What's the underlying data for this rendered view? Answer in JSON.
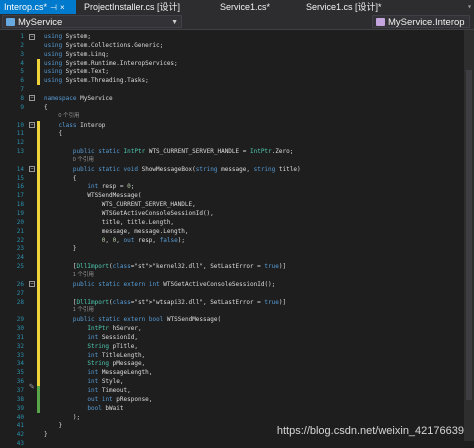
{
  "tabs": [
    {
      "label": "Interop.cs*",
      "icon": "pin-close",
      "active": true
    },
    {
      "label": "ProjectInstaller.cs [设计]",
      "icon": "close",
      "active": false
    },
    {
      "label": "Service1.cs*",
      "icon": "close",
      "active": false
    },
    {
      "label": "Service1.cs [设计]*",
      "icon": "close",
      "active": false
    }
  ],
  "navbar": {
    "project": "MyService",
    "class": "MyService.Interop"
  },
  "code_lines": [
    {
      "n": "1",
      "code": "using System;"
    },
    {
      "n": "2",
      "code": "using System.Collections.Generic;"
    },
    {
      "n": "3",
      "code": "using System.Linq;"
    },
    {
      "n": "4",
      "code": "using System.Runtime.InteropServices;"
    },
    {
      "n": "5",
      "code": "using System.Text;"
    },
    {
      "n": "6",
      "code": "using System.Threading.Tasks;"
    },
    {
      "n": "7",
      "code": ""
    },
    {
      "n": "8",
      "code": "namespace MyService"
    },
    {
      "n": "9",
      "code": "{"
    },
    {
      "n": "",
      "lens": "0 个引用"
    },
    {
      "n": "10",
      "code": "    class Interop"
    },
    {
      "n": "11",
      "code": "    {"
    },
    {
      "n": "12",
      "code": ""
    },
    {
      "n": "13",
      "code": "        public static IntPtr WTS_CURRENT_SERVER_HANDLE = IntPtr.Zero;"
    },
    {
      "n": "",
      "lens": "0 个引用"
    },
    {
      "n": "14",
      "code": "        public static void ShowMessageBox(string message, string title)"
    },
    {
      "n": "15",
      "code": "        {"
    },
    {
      "n": "16",
      "code": "            int resp = 0;"
    },
    {
      "n": "17",
      "code": "            WTSSendMessage("
    },
    {
      "n": "18",
      "code": "                WTS_CURRENT_SERVER_HANDLE,"
    },
    {
      "n": "19",
      "code": "                WTSGetActiveConsoleSessionId(),"
    },
    {
      "n": "20",
      "code": "                title, title.Length,"
    },
    {
      "n": "21",
      "code": "                message, message.Length,"
    },
    {
      "n": "22",
      "code": "                0, 0, out resp, false);"
    },
    {
      "n": "23",
      "code": "        }"
    },
    {
      "n": "24",
      "code": ""
    },
    {
      "n": "25",
      "code": "        [DllImport(\"kernel32.dll\", SetLastError = true)]"
    },
    {
      "n": "",
      "lens": "1 个引用"
    },
    {
      "n": "26",
      "code": "        public static extern int WTSGetActiveConsoleSessionId();"
    },
    {
      "n": "27",
      "code": ""
    },
    {
      "n": "28",
      "code": "        [DllImport(\"wtsapi32.dll\", SetLastError = true)]"
    },
    {
      "n": "",
      "lens": "1 个引用"
    },
    {
      "n": "29",
      "code": "        public static extern bool WTSSendMessage("
    },
    {
      "n": "30",
      "code": "            IntPtr hServer,"
    },
    {
      "n": "31",
      "code": "            int SessionId,"
    },
    {
      "n": "32",
      "code": "            String pTitle,"
    },
    {
      "n": "33",
      "code": "            int TitleLength,"
    },
    {
      "n": "34",
      "code": "            String pMessage,"
    },
    {
      "n": "35",
      "code": "            int MessageLength,"
    },
    {
      "n": "36",
      "code": "            int Style,"
    },
    {
      "n": "37",
      "code": "            int Timeout,"
    },
    {
      "n": "38",
      "code": "            out int pResponse,"
    },
    {
      "n": "39",
      "code": "            bool bWait"
    },
    {
      "n": "40",
      "code": "        );"
    },
    {
      "n": "41",
      "code": "    }"
    },
    {
      "n": "42",
      "code": "}"
    },
    {
      "n": "43",
      "code": ""
    }
  ],
  "watermark": "https://blog.csdn.net/weixin_42176639",
  "colors": {
    "background": "#1e1e1e",
    "tab_active": "#007acc",
    "keyword": "#569cd6",
    "type": "#4ec9b0",
    "string": "#d69d85",
    "line_number": "#2b91af",
    "change_saved": "#57a64a",
    "change_unsaved": "#efd33b"
  }
}
